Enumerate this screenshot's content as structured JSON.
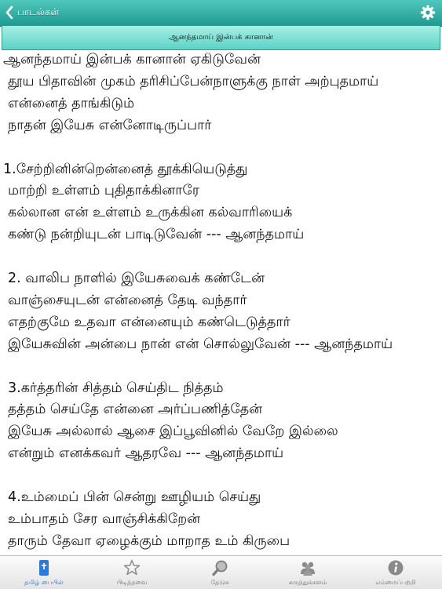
{
  "header": {
    "back_label": "பாடல்கள்",
    "title": "ஆனந்தமாய் இன்பக் கானான்",
    "back_icon": "chevron-left-icon",
    "settings_icon": "gear-icon"
  },
  "colors": {
    "header_top": "#4fc7bd",
    "header_bottom": "#1f9a90",
    "title_top": "#a8efe6",
    "title_bottom": "#5cd3c6",
    "tab_active": "#1e6fd0",
    "tab_inactive": "#8a8a8a"
  },
  "lyrics": [
    "ஆனந்தமாய் இன்பக் கானான் ஏகிடுவேன்",
    " தூய பிதாவின் முகம் தரிசிப்பேன்நாளுக்கு நாள் அற்புதமாய்",
    " என்னைத் தாங்கிடும்",
    " நாதன் இயேசு என்னோடிருப்பார்",
    "",
    "1.சேற்றினின்றென்னைத் தூக்கியெடுத்து",
    " மாற்றி உள்ளம் புதிதாக்கினாரே",
    " கல்லான என் உள்ளம் உருக்கின கல்வாரியைக்",
    " கண்டு நன்றியுடன் பாடிடுவேன் --- ஆனந்தமாய்",
    "",
    " 2. வாலிப நாளில் இயேசுவைக் கண்டேன்",
    " வாஞ்சையுடன் என்னைத் தேடி வந்தார்",
    " எதற்குமே உதவா என்னையும் கண்டெடுத்தார்",
    " இயேசுவின் அன்பை நான் என் சொல்லுவேன் --- ஆனந்தமாய்",
    "",
    " 3.கர்த்தரின் சித்தம் செய்திட நித்தம்",
    " தத்தம் செய்தே என்னை அர்ப்பணித்தேன்",
    " இயேசு அல்லால் ஆசை இப்பூவினில் வேறே இல்லை",
    " என்றும் எனக்கவர் ஆதரவே --- ஆனந்தமாய்",
    "",
    " 4.உம்மைப் பின் சென்று ஊழியம் செய்து",
    " உம்பாதம் சேர வாஞ்சிக்கிறேன்",
    " தாரும் தேவா ஏழைக்கும் மாறாத உம் கிருபை"
  ],
  "tabs": [
    {
      "label": "தமிழ் பைபிள்",
      "icon": "bible-icon",
      "active": true
    },
    {
      "label": "பிடித்தவை",
      "icon": "star-icon",
      "active": false
    },
    {
      "label": "தேடுக",
      "icon": "magnifier-icon",
      "active": false
    },
    {
      "label": "கருத்துக்களம்",
      "icon": "people-icon",
      "active": false
    },
    {
      "label": "எம்மைப்பற்றி",
      "icon": "info-icon",
      "active": false
    }
  ]
}
